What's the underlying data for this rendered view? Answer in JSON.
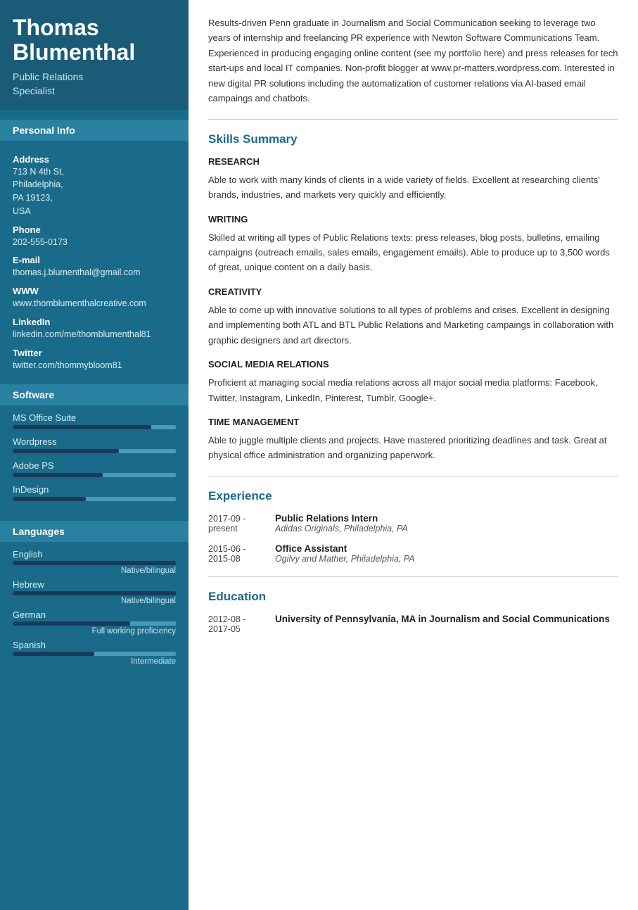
{
  "sidebar": {
    "name_line1": "Thomas",
    "name_line2": "Blumenthal",
    "subtitle": "Public Relations\nSpecialist",
    "personal_info_label": "Personal Info",
    "address_label": "Address",
    "address_value": "713 N 4th St,\nPhiladelphia,\nPA 19123,\nUSA",
    "phone_label": "Phone",
    "phone_value": "202-555-0173",
    "email_label": "E-mail",
    "email_value": "thomas.j.blumenthal@gmail.com",
    "www_label": "WWW",
    "www_value": "www.thomblumenthalcreative.com",
    "linkedin_label": "LinkedIn",
    "linkedin_value": "linkedin.com/me/thomblumenthal81",
    "twitter_label": "Twitter",
    "twitter_value": "twitter.com/thommybloom81",
    "software_label": "Software",
    "software": [
      {
        "name": "MS Office Suite",
        "pct": 85
      },
      {
        "name": "Wordpress",
        "pct": 65
      },
      {
        "name": "Adobe PS",
        "pct": 55
      },
      {
        "name": "InDesign",
        "pct": 45
      }
    ],
    "languages_label": "Languages",
    "languages": [
      {
        "name": "English",
        "pct": 100,
        "level": "Native/bilingual"
      },
      {
        "name": "Hebrew",
        "pct": 100,
        "level": "Native/bilingual"
      },
      {
        "name": "German",
        "pct": 72,
        "level": "Full working proficiency"
      },
      {
        "name": "Spanish",
        "pct": 50,
        "level": "Intermediate"
      }
    ]
  },
  "main": {
    "intro": "Results-driven Penn graduate in Journalism and Social Communication seeking to leverage two years of internship and freelancing PR experience with Newton Software Communications Team. Experienced in producing engaging online content (see my portfolio here) and press releases for tech start-ups and local IT companies. Non-profit blogger at www.pr-matters.wordpress.com. Interested in new digital PR solutions including the automatization of customer relations via AI-based email campaings and chatbots.",
    "skills_summary_title": "Skills Summary",
    "skills": [
      {
        "title": "RESEARCH",
        "text": "Able to work with many kinds of clients in a wide variety of fields. Excellent at researching clients' brands, industries, and markets very quickly and efficiently."
      },
      {
        "title": "WRITING",
        "text": "Skilled at writing all types of Public Relations texts: press releases, blog posts, bulletins, emailing campaigns (outreach emails, sales emails, engagement emails). Able to produce up to 3,500 words of great, unique content on a daily basis."
      },
      {
        "title": "CREATIVITY",
        "text": "Able to come up with innovative solutions to all types of problems and crises. Excellent in designing and implementing both ATL and BTL Public Relations and Marketing campaings in collaboration with graphic designers and art directors."
      },
      {
        "title": "SOCIAL MEDIA RELATIONS",
        "text": "Proficient at managing social media relations across all major social media platforms: Facebook, Twitter, Instagram, LinkedIn, Pinterest, Tumblr, Google+."
      },
      {
        "title": "TIME MANAGEMENT",
        "text": "Able to juggle multiple clients and projects. Have mastered prioritizing deadlines and task. Great at physical office administration and organizing paperwork."
      }
    ],
    "experience_title": "Experience",
    "experience": [
      {
        "date": "2017-09 -\npresent",
        "job_title": "Public Relations Intern",
        "org": "Adidas Originals, Philadelphia, PA"
      },
      {
        "date": "2015-06 -\n2015-08",
        "job_title": "Office Assistant",
        "org": "Ogilvy and Mather, Philadelphia, PA"
      }
    ],
    "education_title": "Education",
    "education": [
      {
        "date": "2012-08 -\n2017-05",
        "degree": "University of Pennsylvania, MA in Journalism and Social Communications"
      }
    ]
  }
}
